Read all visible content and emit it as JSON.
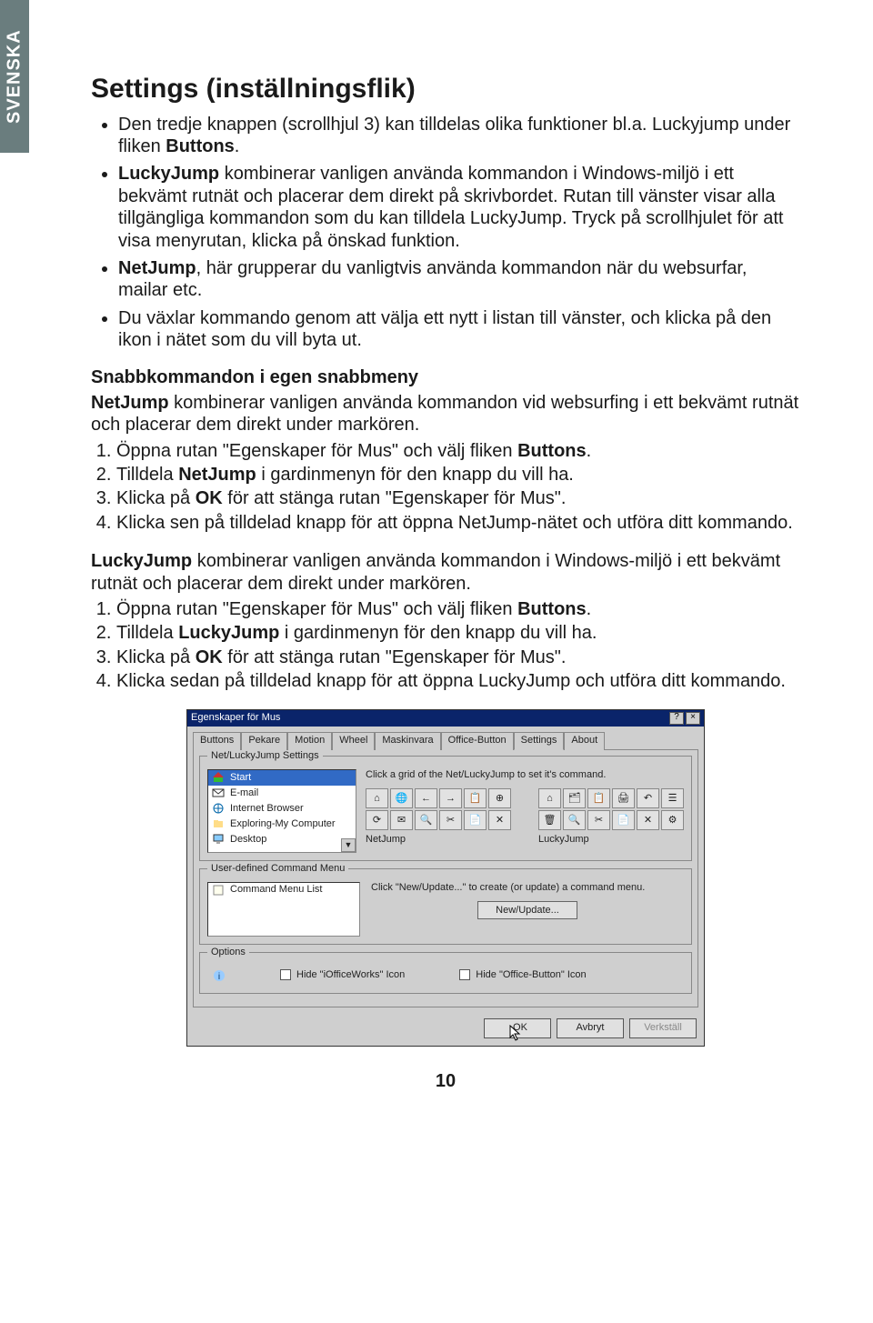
{
  "side_tab": "SVENSKA",
  "heading": "Settings (inställningsflik)",
  "bullets": [
    {
      "pre": "Den tredje knappen (scrollhjul 3) kan tilldelas olika funktioner bl.a. Luckyjump under fliken ",
      "bold": "Buttons",
      "post": "."
    },
    {
      "pre": "",
      "bold": "LuckyJump",
      "post": " kombinerar vanligen använda kommandon i Windows-miljö i ett bekvämt rutnät och placerar dem direkt på skrivbordet. Rutan till vänster visar alla tillgängliga kommandon som du kan tilldela LuckyJump. Tryck på scrollhjulet för att visa menyrutan, klicka på önskad funktion."
    },
    {
      "pre": "",
      "bold": "NetJump",
      "post": ", här grupperar du vanligtvis använda kommandon när du websurfar, mailar etc."
    },
    {
      "pre": "Du växlar kommando genom att välja ett nytt i listan till vänster, och klicka på den ikon i nätet som du vill byta ut.",
      "bold": "",
      "post": ""
    }
  ],
  "subhead1": "Snabbkommandon i egen snabbmeny",
  "para_net_pre": "NetJump",
  "para_net": " kombinerar vanligen använda kommandon vid websurfing i ett bekvämt rutnät och placerar dem direkt under markören.",
  "steps_net": [
    {
      "pre": "Öppna rutan \"Egenskaper för Mus\" och välj fliken ",
      "bold": "Buttons",
      "post": "."
    },
    {
      "pre": "Tilldela ",
      "bold": "NetJump",
      "post": " i gardinmenyn för den knapp du vill ha."
    },
    {
      "pre": "Klicka på ",
      "bold": "OK",
      "post": " för att stänga rutan \"Egenskaper för Mus\"."
    },
    {
      "pre": "Klicka sen på tilldelad knapp för att öppna NetJump-nätet och utföra ditt kommando.",
      "bold": "",
      "post": ""
    }
  ],
  "para_lucky_pre": "LuckyJump",
  "para_lucky": " kombinerar vanligen använda kommandon i Windows-miljö i ett bekvämt rutnät och placerar dem direkt under markören.",
  "steps_lucky": [
    {
      "pre": "Öppna rutan \"Egenskaper för Mus\" och välj fliken ",
      "bold": "Buttons",
      "post": "."
    },
    {
      "pre": "Tilldela ",
      "bold": "LuckyJump",
      "post": " i gardinmenyn för den knapp du vill ha."
    },
    {
      "pre": "Klicka på ",
      "bold": "OK",
      "post": " för att stänga rutan \"Egenskaper för Mus\"."
    },
    {
      "pre": "Klicka sedan på tilldelad knapp för att öppna LuckyJump och utföra ditt kommando.",
      "bold": "",
      "post": ""
    }
  ],
  "dialog": {
    "title": "Egenskaper för Mus",
    "help": "?",
    "close": "×",
    "tabs": [
      "Buttons",
      "Pekare",
      "Motion",
      "Wheel",
      "Maskinvara",
      "Office-Button",
      "Settings",
      "About"
    ],
    "active_tab": 6,
    "group_settings": "Net/LuckyJump Settings",
    "cmd_items": [
      "Start",
      "E-mail",
      "Internet Browser",
      "Exploring-My Computer",
      "Desktop"
    ],
    "cmd_selected": 0,
    "hint_grid": "Click a grid of the Net/LuckyJump to set it's command.",
    "cap_net": "NetJump",
    "cap_lucky": "LuckyJump",
    "group_user": "User-defined Command Menu",
    "user_item": "Command Menu List",
    "user_hint": "Click \"New/Update...\" to create (or update) a command menu.",
    "btn_new": "New/Update...",
    "group_opts": "Options",
    "chk1": "Hide \"iOfficeWorks\" Icon",
    "chk2": "Hide \"Office-Button\" Icon",
    "btn_ok": "OK",
    "btn_cancel": "Avbryt",
    "btn_apply": "Verkställ"
  },
  "page_number": "10"
}
